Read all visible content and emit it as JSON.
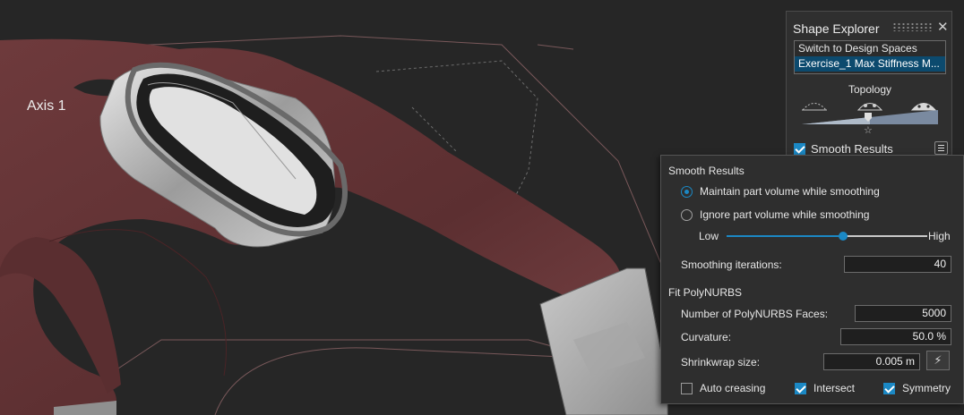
{
  "viewport": {
    "axis_label": "Axis 1",
    "colors": {
      "background": "#262626",
      "part": "#6f3a3b",
      "extrusion": "#b4b4b4"
    }
  },
  "shape_explorer": {
    "title": "Shape Explorer",
    "close_icon": "close-icon",
    "list": [
      "Switch to Design Spaces",
      "Exercise_1 Max Stiffness M..."
    ],
    "selected_index": 1,
    "topology_label": "Topology",
    "topology_level": 0.5,
    "smooth_results": {
      "label": "Smooth Results",
      "checked": true
    }
  },
  "smooth_panel": {
    "section_title": "Smooth Results",
    "maintain_volume": {
      "label": "Maintain part volume while smoothing",
      "selected": true
    },
    "ignore_volume": {
      "label": "Ignore part volume while smoothing",
      "selected": false
    },
    "slider": {
      "low_label": "Low",
      "high_label": "High",
      "value": 0.58
    },
    "iterations": {
      "label": "Smoothing iterations:",
      "value": "40"
    },
    "fit_section_title": "Fit PolyNURBS",
    "faces": {
      "label": "Number of PolyNURBS Faces:",
      "value": "5000"
    },
    "curvature": {
      "label": "Curvature:",
      "value": "50.0 %"
    },
    "shrinkwrap": {
      "label": "Shrinkwrap size:",
      "value": "0.005 m",
      "button_icon": "lightning-icon"
    },
    "auto_creasing": {
      "label": "Auto creasing",
      "checked": false
    },
    "intersect": {
      "label": "Intersect",
      "checked": true
    },
    "symmetry": {
      "label": "Symmetry",
      "checked": true
    },
    "accent_color": "#1b88c4"
  }
}
